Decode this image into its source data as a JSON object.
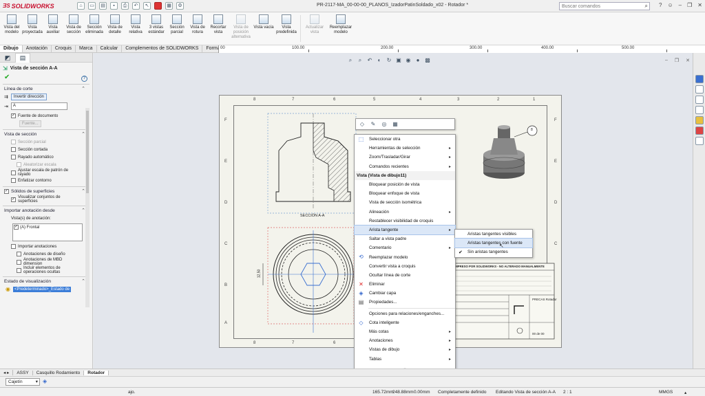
{
  "app": {
    "name": "SOLIDWORKS",
    "doc_title": "PR-2117-MA_00-00-00_PLANOS_IzadorPatinSoldado_x02 - Rotador *"
  },
  "search": {
    "placeholder": "Buscar comandos"
  },
  "ribbon": [
    {
      "label": "Vista del modelo",
      "enabled": true
    },
    {
      "label": "Vista proyectada",
      "enabled": true
    },
    {
      "label": "Vista auxiliar",
      "enabled": true
    },
    {
      "label": "Vista de sección",
      "enabled": true
    },
    {
      "label": "Sección eliminada",
      "enabled": true
    },
    {
      "label": "Vista de detalle",
      "enabled": true
    },
    {
      "label": "Vista relativa",
      "enabled": true
    },
    {
      "label": "3 vistas estándar",
      "enabled": true
    },
    {
      "label": "Sección parcial",
      "enabled": true
    },
    {
      "label": "Vista de rotura",
      "enabled": true
    },
    {
      "label": "Recortar vista",
      "enabled": true
    },
    {
      "label": "Vista de posición alternativa",
      "enabled": false
    },
    {
      "label": "Vista vacía",
      "enabled": true
    },
    {
      "label": "Vista predefinida",
      "enabled": true
    },
    {
      "label": "Actualizar vista",
      "enabled": false
    },
    {
      "label": "Reemplazar modelo",
      "enabled": true
    }
  ],
  "tabs": [
    "Dibujo",
    "Anotación",
    "Croquis",
    "Marca",
    "Calcular",
    "Complementos de SOLIDWORKS",
    "Formato de hoja"
  ],
  "ruler": [
    "00",
    "100.00",
    "200.00",
    "300.00",
    "400.00",
    "500.00"
  ],
  "panel": {
    "title": "Vista de sección A-A",
    "linea_corte": {
      "head": "Línea de corte",
      "invert_btn": "Invertir dirección",
      "label_value": "A",
      "doc_font": "Fuente de documento",
      "font_btn": "Fuente..."
    },
    "vista_seccion": {
      "head": "Vista de sección",
      "items": [
        {
          "label": "Sección parcial",
          "checked": false,
          "gray": true
        },
        {
          "label": "Sección cortada",
          "checked": false,
          "gray": false
        },
        {
          "label": "Rayado automático",
          "checked": false,
          "gray": false
        },
        {
          "label": "Aleatorizar escala",
          "checked": false,
          "gray": true
        },
        {
          "label": "Ajustar escala de patrón de rayado",
          "checked": false,
          "gray": false
        },
        {
          "label": "Enfatizar contorno",
          "checked": false,
          "gray": false
        }
      ]
    },
    "solidos": {
      "head": "Sólidos de superficies",
      "item": "Visualizar conjuntos de superficies"
    },
    "importar": {
      "head": "Importar anotación desde",
      "vistas_label": "Vista(s) de anotación:",
      "list_item": "(A) Frontal",
      "items": [
        "Importar anotaciones",
        "Anotaciones de diseño",
        "Anotaciones de MBD dimension",
        "Incluir elementos de operaciones ocultas"
      ]
    },
    "estado": {
      "head": "Estado de visualización",
      "value": "<Predeterminado>_Estado de"
    }
  },
  "sheet": {
    "zones_top": [
      "8",
      "7",
      "6",
      "5",
      "4",
      "3",
      "2",
      "1"
    ],
    "zones_side": [
      "F",
      "E",
      "D",
      "C",
      "B",
      "A"
    ],
    "section_label": "SECCIÓN A-A",
    "dim_label": "12,50",
    "balloon": "8",
    "title_block_head": "IMPRESO POR SOLIDWORKS - NO ALTERADO MANUALMENTE",
    "company": "PRECAS Rotador",
    "date_label": "00 de 00"
  },
  "context_mini_icons": [
    "smart-dim-icon",
    "note-icon",
    "balloon-icon",
    "table-icon"
  ],
  "context_menu": [
    {
      "label": "Seleccionar otra",
      "icon": "select-icon",
      "sub": false
    },
    {
      "label": "Herramientas de selección",
      "sub": true
    },
    {
      "label": "Zoom/Trasladar/Girar",
      "sub": true
    },
    {
      "label": "Comandos recientes",
      "sub": true
    },
    {
      "header": "Vista (Vista de dibujo11)"
    },
    {
      "label": "Bloquear posición de vista",
      "sub": false
    },
    {
      "label": "Bloquear enfoque de vista",
      "sub": false
    },
    {
      "label": "Vista de sección isométrica",
      "sub": false
    },
    {
      "label": "Alineación",
      "sub": true
    },
    {
      "label": "Restablecer visibilidad de croquis",
      "sub": false
    },
    {
      "label": "Arista tangente",
      "sub": true,
      "highlight": true
    },
    {
      "label": "Saltar a vista padre",
      "sub": false
    },
    {
      "label": "Comentario",
      "sub": true
    },
    {
      "label": "Reemplazar modelo",
      "icon": "replace-model-icon",
      "sub": false
    },
    {
      "label": "Convertir vista a croquis",
      "sub": false
    },
    {
      "label": "Ocultar línea de corte",
      "sub": false
    },
    {
      "label": "Eliminar",
      "icon": "delete-icon",
      "sub": false
    },
    {
      "label": "Cambiar capa",
      "icon": "layer-icon",
      "sub": false
    },
    {
      "label": "Propiedades...",
      "icon": "properties-icon",
      "sub": false
    },
    {
      "sep": true
    },
    {
      "label": "Opciones para relaciones/enganches...",
      "sub": false
    },
    {
      "label": "Cota inteligente",
      "icon": "smart-dim-icon",
      "sub": false
    },
    {
      "label": "Más cotas",
      "sub": true
    },
    {
      "label": "Anotaciones",
      "sub": true
    },
    {
      "label": "Vistas de dibujo",
      "sub": true
    },
    {
      "label": "Tablas",
      "sub": true
    }
  ],
  "context_more": "⌄",
  "submenu": [
    {
      "label": "Aristas tangentes visibles",
      "checked": false
    },
    {
      "label": "Aristas tangentes con fuente",
      "checked": false,
      "highlight": true
    },
    {
      "label": "Sin aristas tangentes",
      "checked": true
    }
  ],
  "bottom_tabs": [
    {
      "label": "ASSY",
      "active": false
    },
    {
      "label": "Casquillo Rodamiento",
      "active": false
    },
    {
      "label": "Rotador",
      "active": true
    }
  ],
  "layer": "Cajetín",
  "status": {
    "left": "ajo.",
    "x": "165.72mm",
    "y": "248.88mm",
    "z": "0.00mm",
    "state": "Completamente definido",
    "editing": "Editando Vista de sección A-A",
    "scale": "2 : 1",
    "units": "MMGS"
  },
  "colors": {
    "accent": "#3b7dd8",
    "brand": "#c8102e",
    "highlight": "#dbe7f7"
  }
}
